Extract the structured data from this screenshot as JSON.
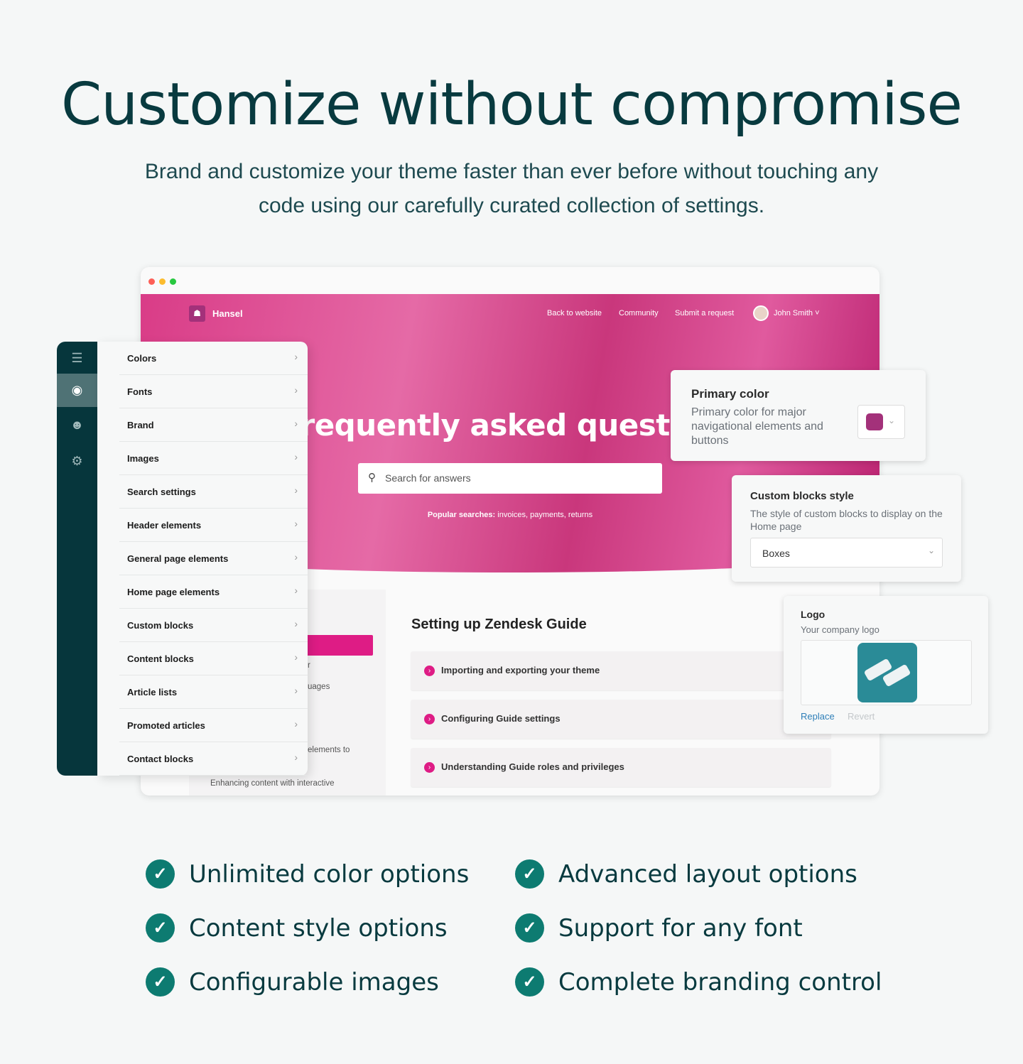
{
  "headline": "Customize without compromise",
  "subtitle": "Brand and customize your theme faster than ever before without touching any code using our carefully curated collection of settings.",
  "browser": {
    "brand": "Hansel",
    "nav": [
      "Back to website",
      "Community",
      "Submit a request"
    ],
    "user": "John Smith",
    "hero_title": "Frequently asked questions",
    "search_placeholder": "Search for answers",
    "popular_label": "Popular searches:",
    "popular": "invoices,  payments,  returns",
    "fragments": [
      "r",
      "uages",
      "elements to",
      "Enhancing content with interactive"
    ],
    "section_title": "Setting up Zendesk Guide",
    "articles": [
      "Importing and exporting your theme",
      "Configuring Guide settings",
      "Understanding Guide roles and privileges"
    ]
  },
  "sidebar_icons": [
    "menu-icon",
    "eye-icon",
    "user-lock-icon",
    "gear-icon"
  ],
  "menu": [
    "Colors",
    "Fonts",
    "Brand",
    "Images",
    "Search settings",
    "Header elements",
    "General page elements",
    "Home page elements",
    "Custom blocks",
    "Content blocks",
    "Article lists",
    "Promoted articles",
    "Contact blocks"
  ],
  "primary_color": {
    "title": "Primary color",
    "desc": "Primary color for major navigational elements and buttons",
    "value": "#a3317a"
  },
  "custom_blocks": {
    "title": "Custom blocks style",
    "desc": "The style of custom blocks to display on the Home page",
    "value": "Boxes"
  },
  "logo": {
    "title": "Logo",
    "desc": "Your company logo",
    "replace": "Replace",
    "revert": "Revert"
  },
  "features": [
    "Unlimited color options",
    "Advanced layout options",
    "Content style options",
    "Support for any font",
    "Configurable images",
    "Complete branding control"
  ],
  "colors": {
    "accent": "#de1c85",
    "dark": "#06363c",
    "check": "#0d7b71"
  }
}
